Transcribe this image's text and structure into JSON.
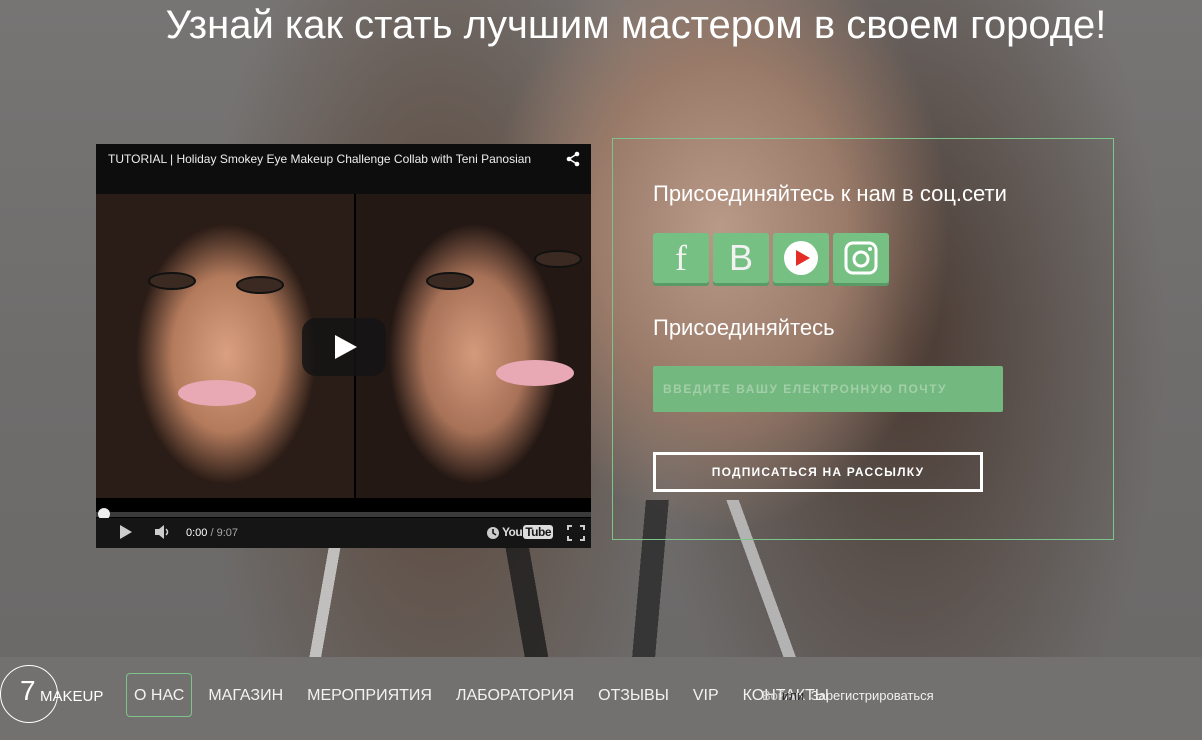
{
  "headline": "Узнай как стать лучшим мастером в своем городе!",
  "video": {
    "title": "TUTORIAL | Holiday Smokey Eye Makeup Challenge Collab with Teni Panosian",
    "time_current": "0:00",
    "time_separator": " / ",
    "time_total": "9:07",
    "logo_text": "You",
    "logo_tube": "Tube",
    "progress": 0
  },
  "panel": {
    "social_heading": "Присоединяйтесь к нам в соц.сети",
    "social": [
      {
        "name": "facebook",
        "glyph": "f"
      },
      {
        "name": "vkontakte",
        "glyph": "B"
      },
      {
        "name": "youtube",
        "glyph": "play"
      },
      {
        "name": "instagram",
        "glyph": "camera"
      }
    ],
    "join_heading": "Присоединяйтесь",
    "email_placeholder": "ВВЕДИТЕ ВАШУ ЕЛЕКТРОННУЮ ПОЧТУ",
    "subscribe_label": "ПОДПИСАТЬСЯ НА РАССЫЛКУ",
    "accent": "#77c084"
  },
  "navbar": {
    "logo_number": "7",
    "logo_text": "MAKEUP",
    "items": [
      {
        "label": "О НАС",
        "active": true
      },
      {
        "label": "МАГАЗИН"
      },
      {
        "label": "МЕРОПРИЯТИЯ"
      },
      {
        "label": "ЛАБОРАТОРИЯ"
      },
      {
        "label": "ОТЗЫВЫ"
      },
      {
        "label": "VIP"
      },
      {
        "label": "КОНТАКТЫ"
      }
    ],
    "login": "Войти",
    "or": "или",
    "register": "Зарегистрироваться"
  }
}
